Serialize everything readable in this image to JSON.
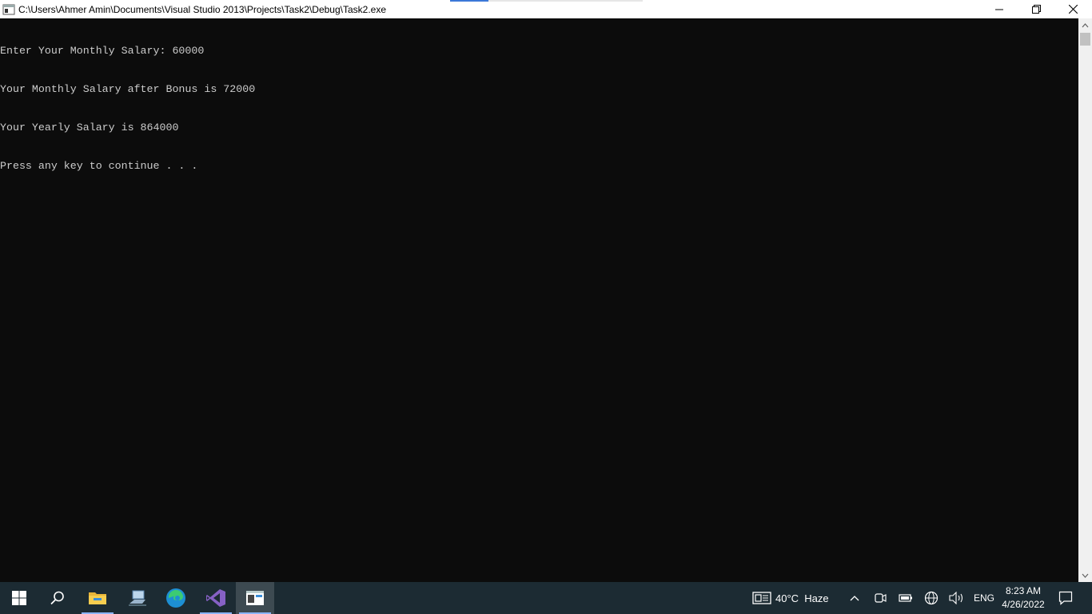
{
  "window": {
    "title": "C:\\Users\\Ahmer Amin\\Documents\\Visual Studio 2013\\Projects\\Task2\\Debug\\Task2.exe"
  },
  "console": {
    "lines": [
      "Enter Your Monthly Salary: 60000",
      "Your Monthly Salary after Bonus is 72000",
      "Your Yearly Salary is 864000",
      "Press any key to continue . . ."
    ]
  },
  "taskbar": {
    "apps": [
      {
        "name": "start",
        "icon": "windows-logo-icon"
      },
      {
        "name": "search",
        "icon": "search-icon"
      },
      {
        "name": "file-explorer",
        "icon": "folder-icon"
      },
      {
        "name": "network-computer",
        "icon": "computer-icon"
      },
      {
        "name": "edge",
        "icon": "edge-icon"
      },
      {
        "name": "visual-studio",
        "icon": "visual-studio-icon"
      },
      {
        "name": "console-window",
        "icon": "console-icon"
      }
    ],
    "weather": "40°C  Haze",
    "language": "ENG",
    "time": "8:23 AM",
    "date": "4/26/2022"
  },
  "colors": {
    "console_bg": "#0c0c0c",
    "console_text": "#cccccc",
    "taskbar_bg": "#1c2b33",
    "accent": "#8ab4f8"
  }
}
